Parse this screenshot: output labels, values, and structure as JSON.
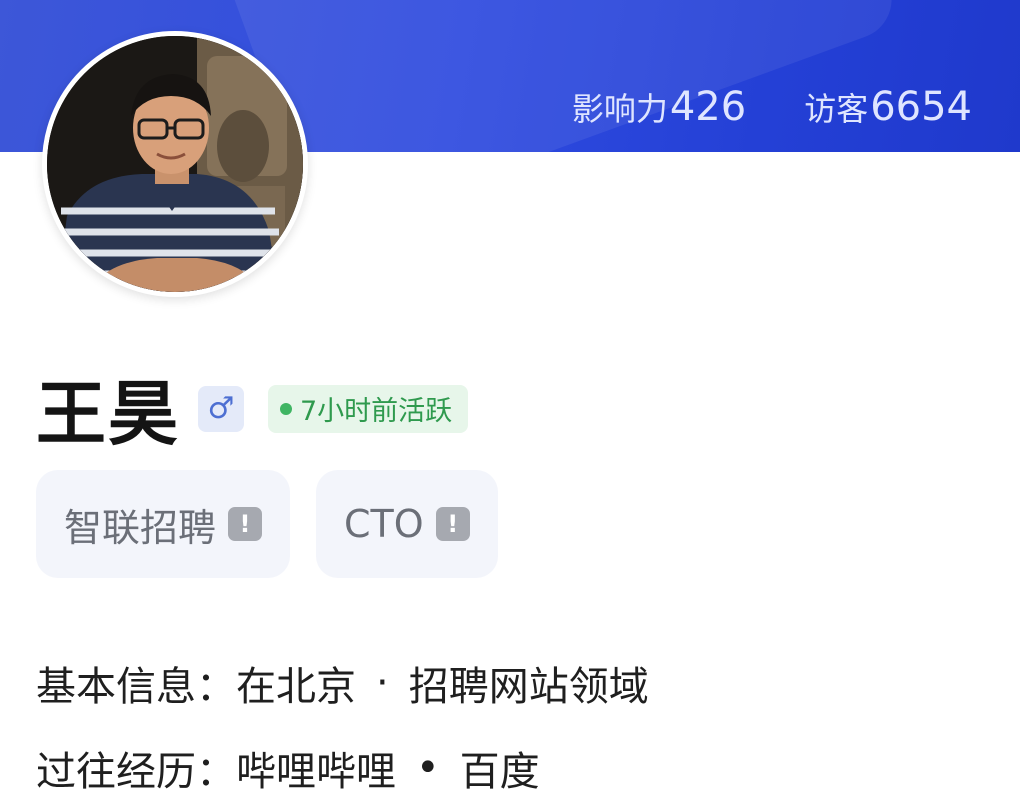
{
  "stats": {
    "influence_label": "影响力",
    "influence_value": "426",
    "visitors_label": "访客",
    "visitors_value": "6654"
  },
  "profile": {
    "name": "王昊",
    "gender_symbol": "♂",
    "active_status": "7小时前活跃"
  },
  "tags": [
    {
      "label": "智联招聘",
      "icon": "!"
    },
    {
      "label": "CTO",
      "icon": "!"
    }
  ],
  "info": {
    "basic_label": "基本信息：",
    "basic_items": [
      "在北京",
      "招聘网站领域"
    ],
    "basic_separator": "·",
    "history_label": "过往经历：",
    "history_items": [
      "哔哩哔哩",
      "百度"
    ],
    "history_separator": "•"
  },
  "colors": {
    "header": "#2f4bdf",
    "active_green": "#2f9a4e",
    "gender_blue": "#4d6fd2"
  }
}
